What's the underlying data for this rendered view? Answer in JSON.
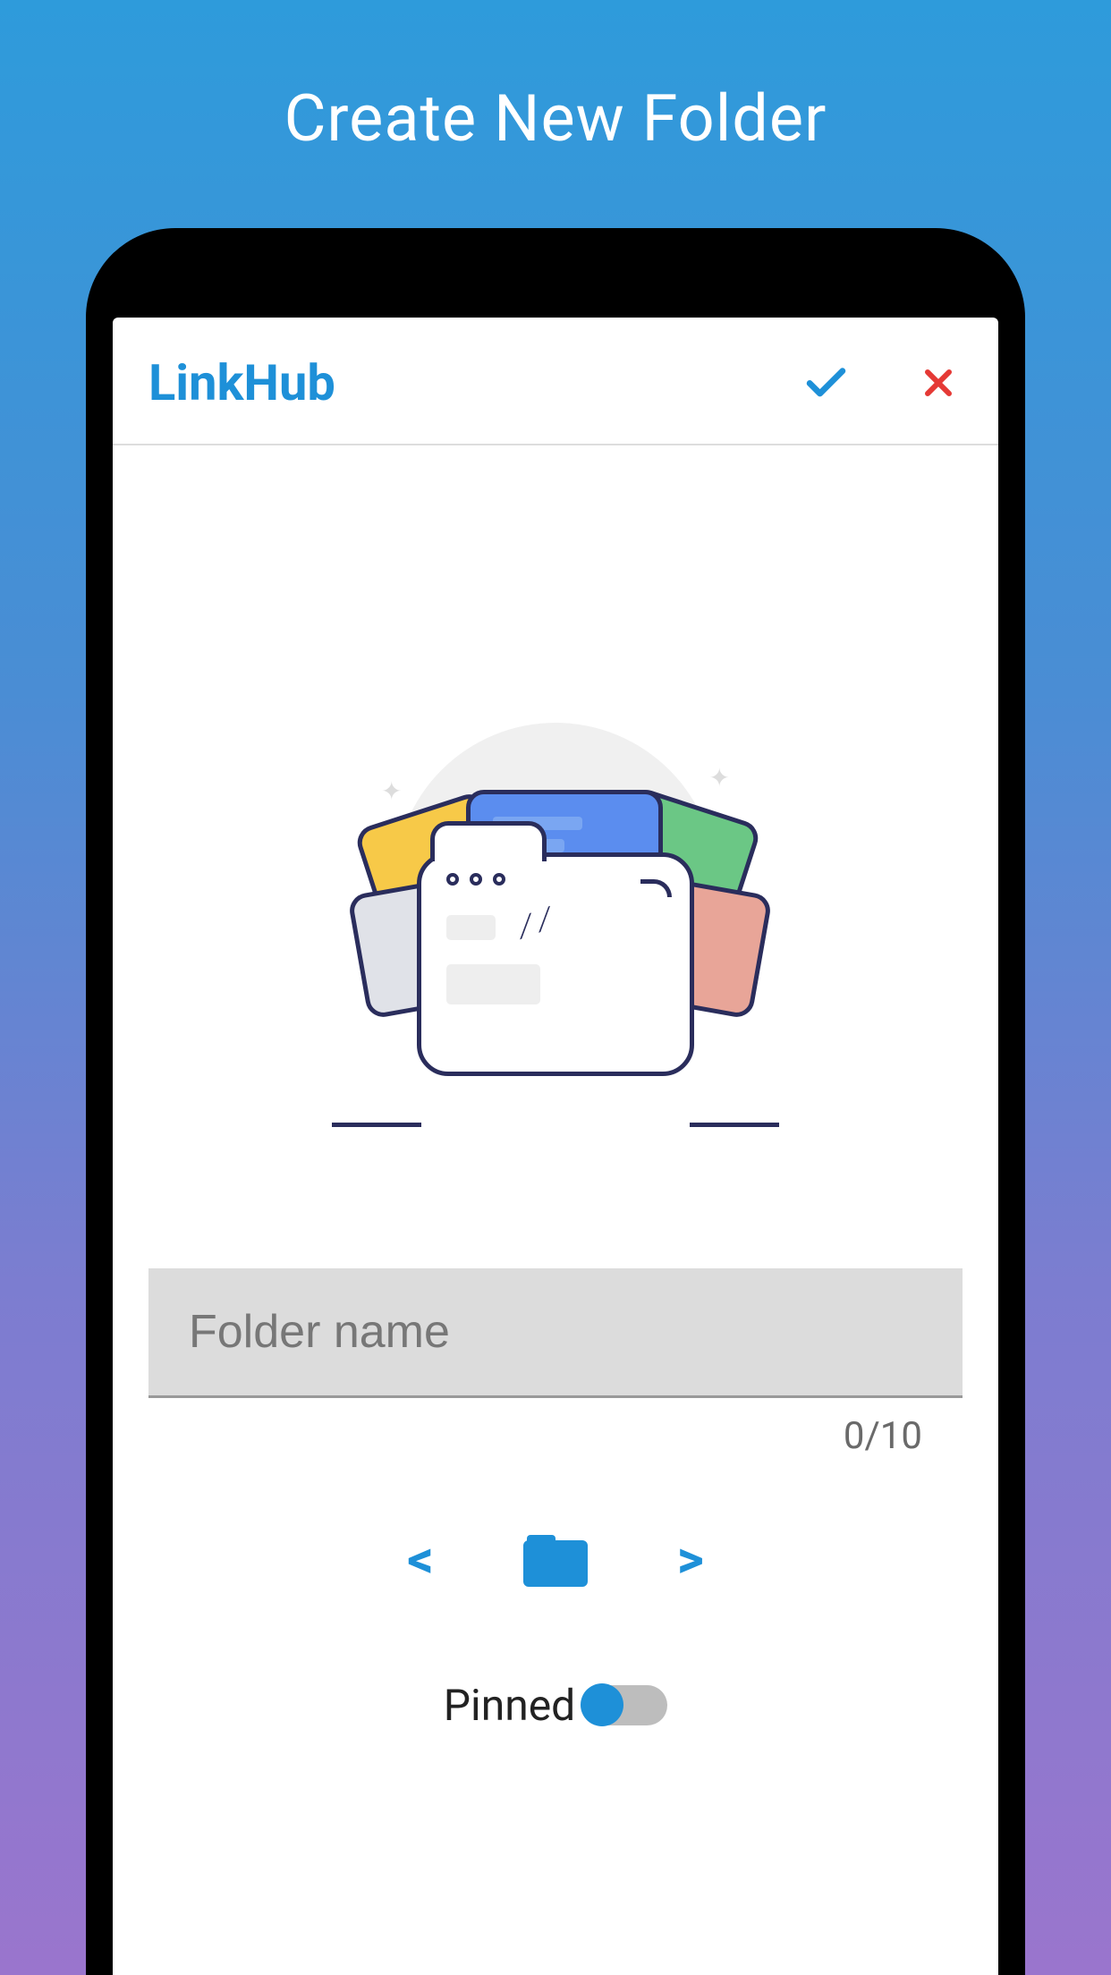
{
  "page": {
    "title": "Create New Folder"
  },
  "header": {
    "app_name": "LinkHub"
  },
  "input": {
    "placeholder": "Folder name",
    "value": "",
    "counter": "0/10"
  },
  "navigation": {
    "prev": "<",
    "next": ">"
  },
  "pinned": {
    "label": "Pinned",
    "state": false
  }
}
